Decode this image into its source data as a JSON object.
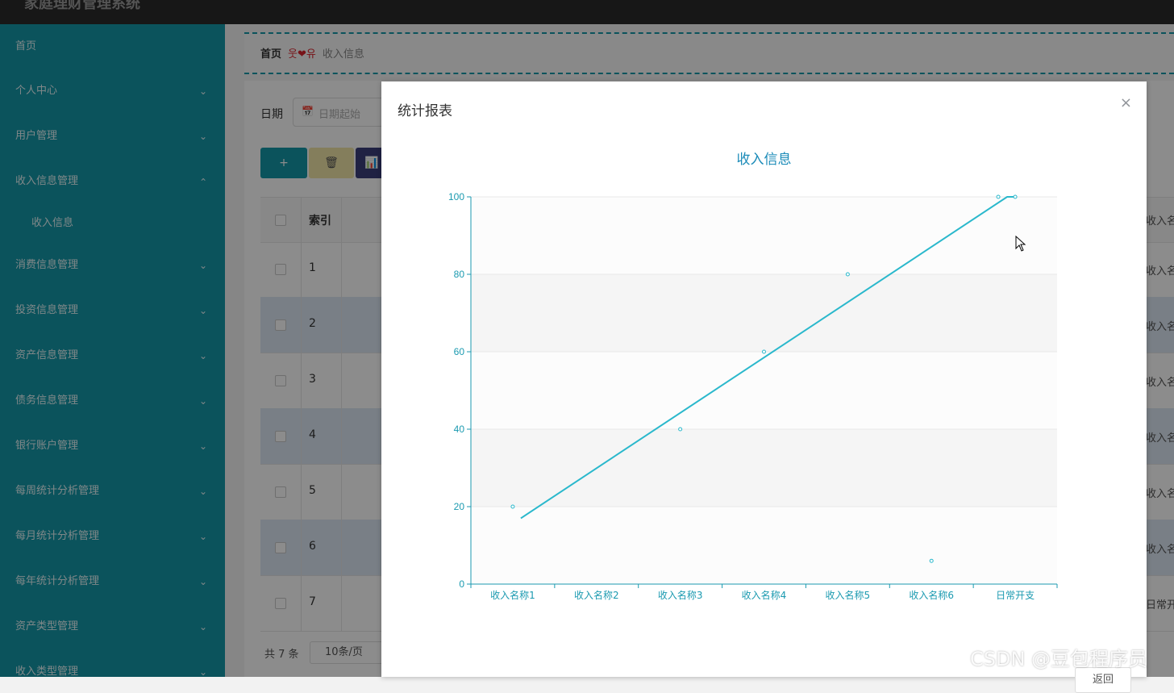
{
  "app": {
    "brand": "家庭理财管理系统"
  },
  "sidebar": {
    "items": [
      {
        "label": "首页",
        "expandable": false
      },
      {
        "label": "个人中心",
        "expandable": true
      },
      {
        "label": "用户管理",
        "expandable": true
      },
      {
        "label": "收入信息管理",
        "expandable": true,
        "expanded": true
      },
      {
        "label": "收入信息",
        "sub": true
      },
      {
        "label": "消费信息管理",
        "expandable": true
      },
      {
        "label": "投资信息管理",
        "expandable": true
      },
      {
        "label": "资产信息管理",
        "expandable": true
      },
      {
        "label": "债务信息管理",
        "expandable": true
      },
      {
        "label": "银行账户管理",
        "expandable": true
      },
      {
        "label": "每周统计分析管理",
        "expandable": true
      },
      {
        "label": "每月统计分析管理",
        "expandable": true
      },
      {
        "label": "每年统计分析管理",
        "expandable": true
      },
      {
        "label": "资产类型管理",
        "expandable": true
      },
      {
        "label": "收入类型管理",
        "expandable": true
      }
    ]
  },
  "breadcrumb": {
    "home": "首页",
    "separator": "웃❤유",
    "current": "收入信息"
  },
  "filter": {
    "date_label": "日期",
    "date_placeholder": "日期起始"
  },
  "toolbar": {
    "add_label": "+",
    "delete_label": "🗑",
    "stat_label": "📊"
  },
  "table": {
    "header_index": "索引",
    "header_right": "收入名",
    "rows": [
      {
        "index": "1",
        "right": "收入名"
      },
      {
        "index": "2",
        "right": "收入名"
      },
      {
        "index": "3",
        "right": "收入名"
      },
      {
        "index": "4",
        "right": "收入名"
      },
      {
        "index": "5",
        "right": "收入名"
      },
      {
        "index": "6",
        "right": "收入名"
      },
      {
        "index": "7",
        "right": "日常开"
      }
    ]
  },
  "pager": {
    "total": "共 7 条",
    "page_size": "10条/页"
  },
  "modal": {
    "title": "统计报表",
    "close": "×",
    "back_button": "返回"
  },
  "chart_data": {
    "type": "line",
    "title": "收入信息",
    "categories": [
      "收入名称1",
      "收入名称2",
      "收入名称3",
      "收入名称4",
      "收入名称5",
      "收入名称6",
      "日常开支"
    ],
    "points": [
      20,
      40,
      60,
      80,
      6,
      100
    ],
    "point_categories": [
      "收入名称1",
      "收入名称3",
      "收入名称4",
      "收入名称5",
      "收入名称6",
      "日常开支"
    ],
    "trend": [
      17,
      100
    ],
    "ylim": [
      0,
      100
    ],
    "yticks": [
      0,
      20,
      40,
      60,
      80,
      100
    ],
    "grid": "horizontal-bands",
    "colors": {
      "line": "#2ab8cc",
      "axis": "#1b9ab0",
      "title": "#1b8bb8"
    }
  },
  "watermark": "CSDN @豆包程序员"
}
